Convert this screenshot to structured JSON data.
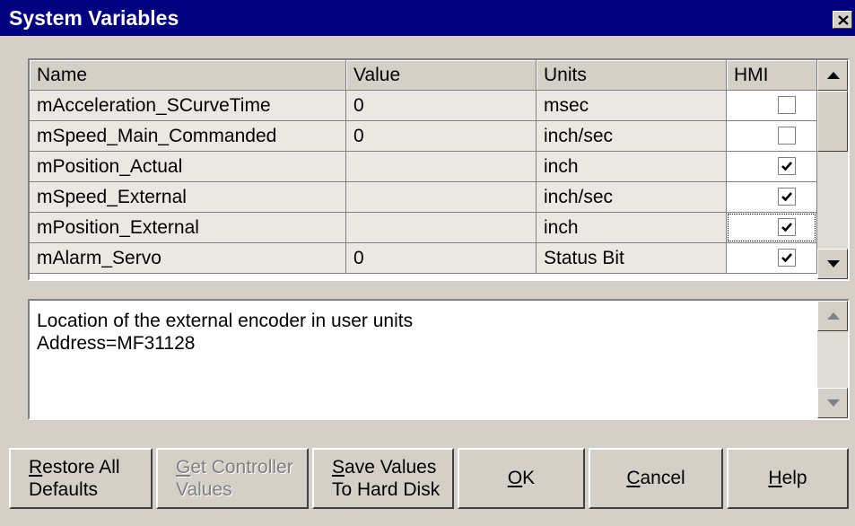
{
  "window": {
    "title": "System Variables"
  },
  "grid": {
    "headers": {
      "name": "Name",
      "value": "Value",
      "units": "Units",
      "hmi": "HMI"
    },
    "rows": [
      {
        "name": "mAcceleration_SCurveTime",
        "value": "0",
        "units": "msec",
        "hmi": false
      },
      {
        "name": "mSpeed_Main_Commanded",
        "value": "0",
        "units": "inch/sec",
        "hmi": false
      },
      {
        "name": "mPosition_Actual",
        "value": "",
        "units": "inch",
        "hmi": true
      },
      {
        "name": "mSpeed_External",
        "value": "",
        "units": "inch/sec",
        "hmi": true
      },
      {
        "name": "mPosition_External",
        "value": "",
        "units": "inch",
        "hmi": true,
        "focused": true
      },
      {
        "name": "mAlarm_Servo",
        "value": "0",
        "units": "Status Bit",
        "hmi": true
      }
    ]
  },
  "description": {
    "line1": "Location of the external encoder in user units",
    "line2": "Address=MF31128"
  },
  "buttons": {
    "restore": {
      "mnemonic": "R",
      "rest": "estore All",
      "line2": "Defaults"
    },
    "get_controller": {
      "mnemonic": "G",
      "rest": "et Controller",
      "line2": "Values",
      "disabled": true
    },
    "save_values": {
      "mnemonic": "S",
      "rest": "ave Values",
      "line2": "To Hard Disk"
    },
    "ok": {
      "mnemonic": "O",
      "rest": "K"
    },
    "cancel": {
      "mnemonic": "C",
      "rest": "ancel"
    },
    "help": {
      "mnemonic": "H",
      "rest": "elp"
    }
  },
  "colors": {
    "titlebar": "#000080",
    "face": "#d4d0c8",
    "cell": "#ebe8e4"
  },
  "icons": [
    "close-icon",
    "scroll-up-arrow-icon",
    "scroll-down-arrow-icon",
    "checkmark-icon"
  ]
}
